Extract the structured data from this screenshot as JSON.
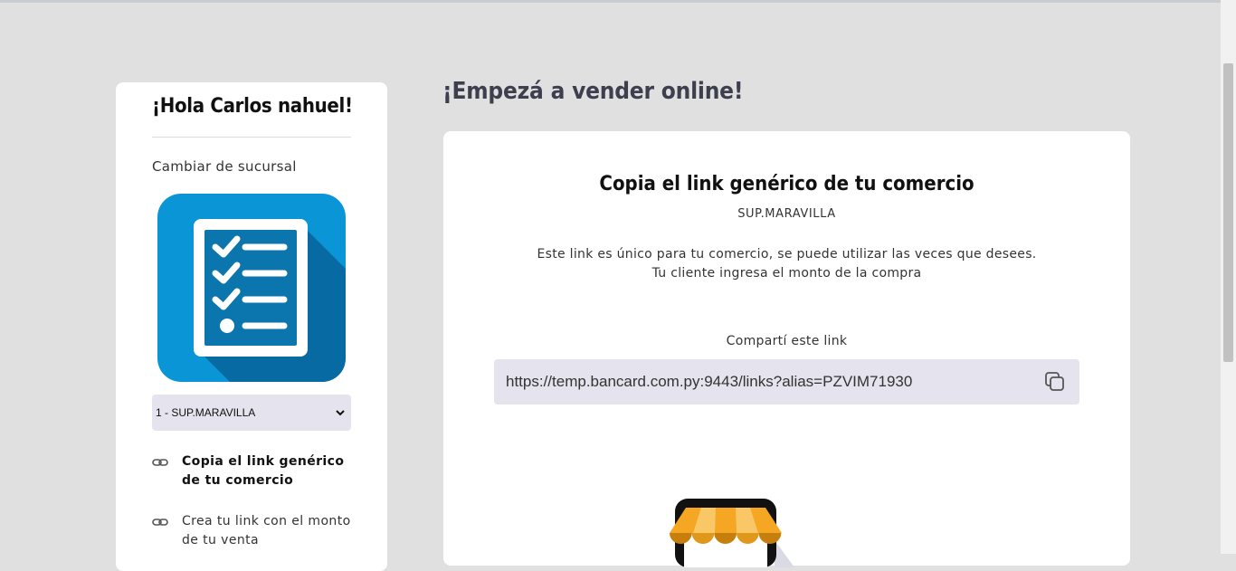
{
  "sidebar": {
    "greeting": "¡Hola Carlos nahuel!",
    "change_branch": "Cambiar de sucursal",
    "app_icon": "checklist-icon",
    "branch_select": {
      "selected": "1 - SUP.MARAVILLA"
    },
    "menu": [
      {
        "label": "Copia el link genérico de tu comercio",
        "icon": "link-icon",
        "active": true
      },
      {
        "label": "Crea tu link con el monto de tu venta",
        "icon": "link-icon",
        "active": false
      }
    ]
  },
  "main": {
    "title": "¡Empezá a vender online!",
    "card": {
      "title": "Copia el link genérico de tu comercio",
      "merchant": "SUP.MARAVILLA",
      "desc_line1": "Este link es único para tu comercio, se puede utilizar las veces que desees.",
      "desc_line2": "Tu cliente ingresa el monto de la compra",
      "share_label": "Compartí este link",
      "link": "https://temp.bancard.com.py:9443/links?alias=PZVIM71930",
      "copy_icon": "copy-icon",
      "illustration": "storefront-icon"
    }
  },
  "colors": {
    "background": "#e0e0e0",
    "card": "#ffffff",
    "input_bg": "#e4e3ee",
    "icon_blue": "#0a96d6",
    "icon_dark_blue": "#076aa2",
    "awning_orange": "#f5a623"
  }
}
